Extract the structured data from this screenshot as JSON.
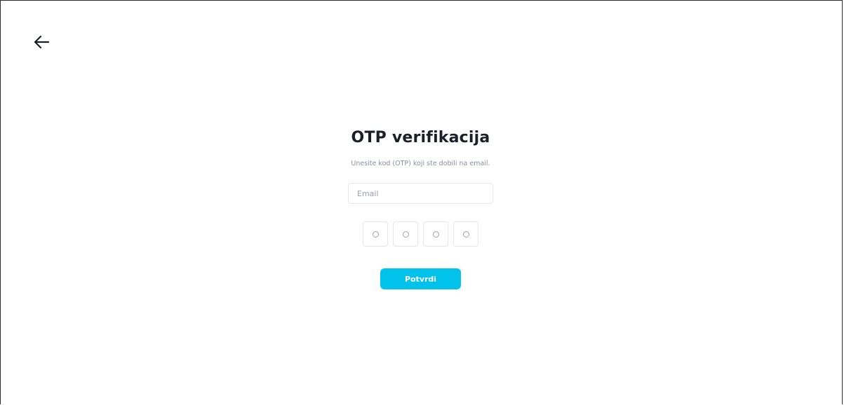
{
  "header": {
    "back_icon": "arrow-left-icon"
  },
  "form": {
    "title": "OTP verifikacija",
    "subtitle": "Unesite kod (OTP) koji ste dobili na email.",
    "email": {
      "placeholder": "Email",
      "value": ""
    },
    "otp": {
      "digits": [
        "",
        "",
        "",
        ""
      ],
      "placeholder_icon": "circle-outline-icon"
    },
    "submit_label": "Potvrdi"
  },
  "colors": {
    "accent": "#00c2ea",
    "title": "#1c1f2a",
    "muted": "#8a8f9c",
    "border": "#e3e6ea"
  }
}
